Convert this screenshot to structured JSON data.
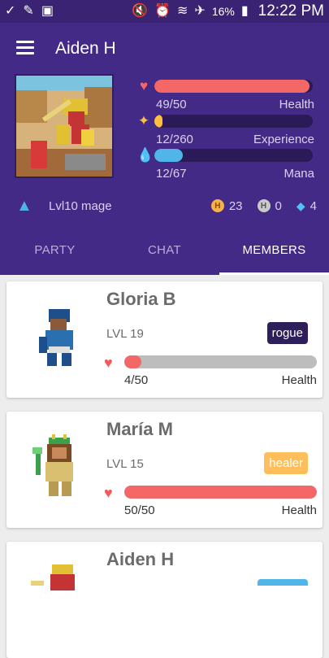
{
  "status_bar": {
    "battery": "16%",
    "time": "12:22 PM"
  },
  "header": {
    "user_name": "Aiden H",
    "stats": [
      {
        "icon": "heart-icon",
        "value": "49/50",
        "label": "Health",
        "fraction": 0.98,
        "color": "#f46767"
      },
      {
        "icon": "sparkle-icon",
        "value": "12/260",
        "label": "Experience",
        "fraction": 0.046,
        "color": "#ffbe3d"
      },
      {
        "icon": "drop-icon",
        "value": "12/67",
        "label": "Mana",
        "fraction": 0.179,
        "color": "#50b5e9"
      }
    ],
    "level": "Lvl10 mage",
    "currencies": [
      {
        "icon": "hourglass-coin-icon",
        "value": "23"
      },
      {
        "icon": "hourglass-coin-icon",
        "value": "0"
      },
      {
        "icon": "gem-icon",
        "value": "4"
      }
    ]
  },
  "tabs": [
    "PARTY",
    "CHAT",
    "MEMBERS"
  ],
  "active_tab": "MEMBERS",
  "members": [
    {
      "name": "Gloria B",
      "level": "LVL 19",
      "class": "rogue",
      "class_bg": "#2e1e5a",
      "class_fg": "#ffffff",
      "hp": "4/50",
      "hp_fraction": 0.08,
      "hp_label": "Health"
    },
    {
      "name": "María M",
      "level": "LVL 15",
      "class": "healer",
      "class_bg": "#ffbe5c",
      "class_fg": "#ffffff",
      "hp": "50/50",
      "hp_fraction": 1.0,
      "hp_label": "Health"
    },
    {
      "name": "Aiden H"
    }
  ]
}
